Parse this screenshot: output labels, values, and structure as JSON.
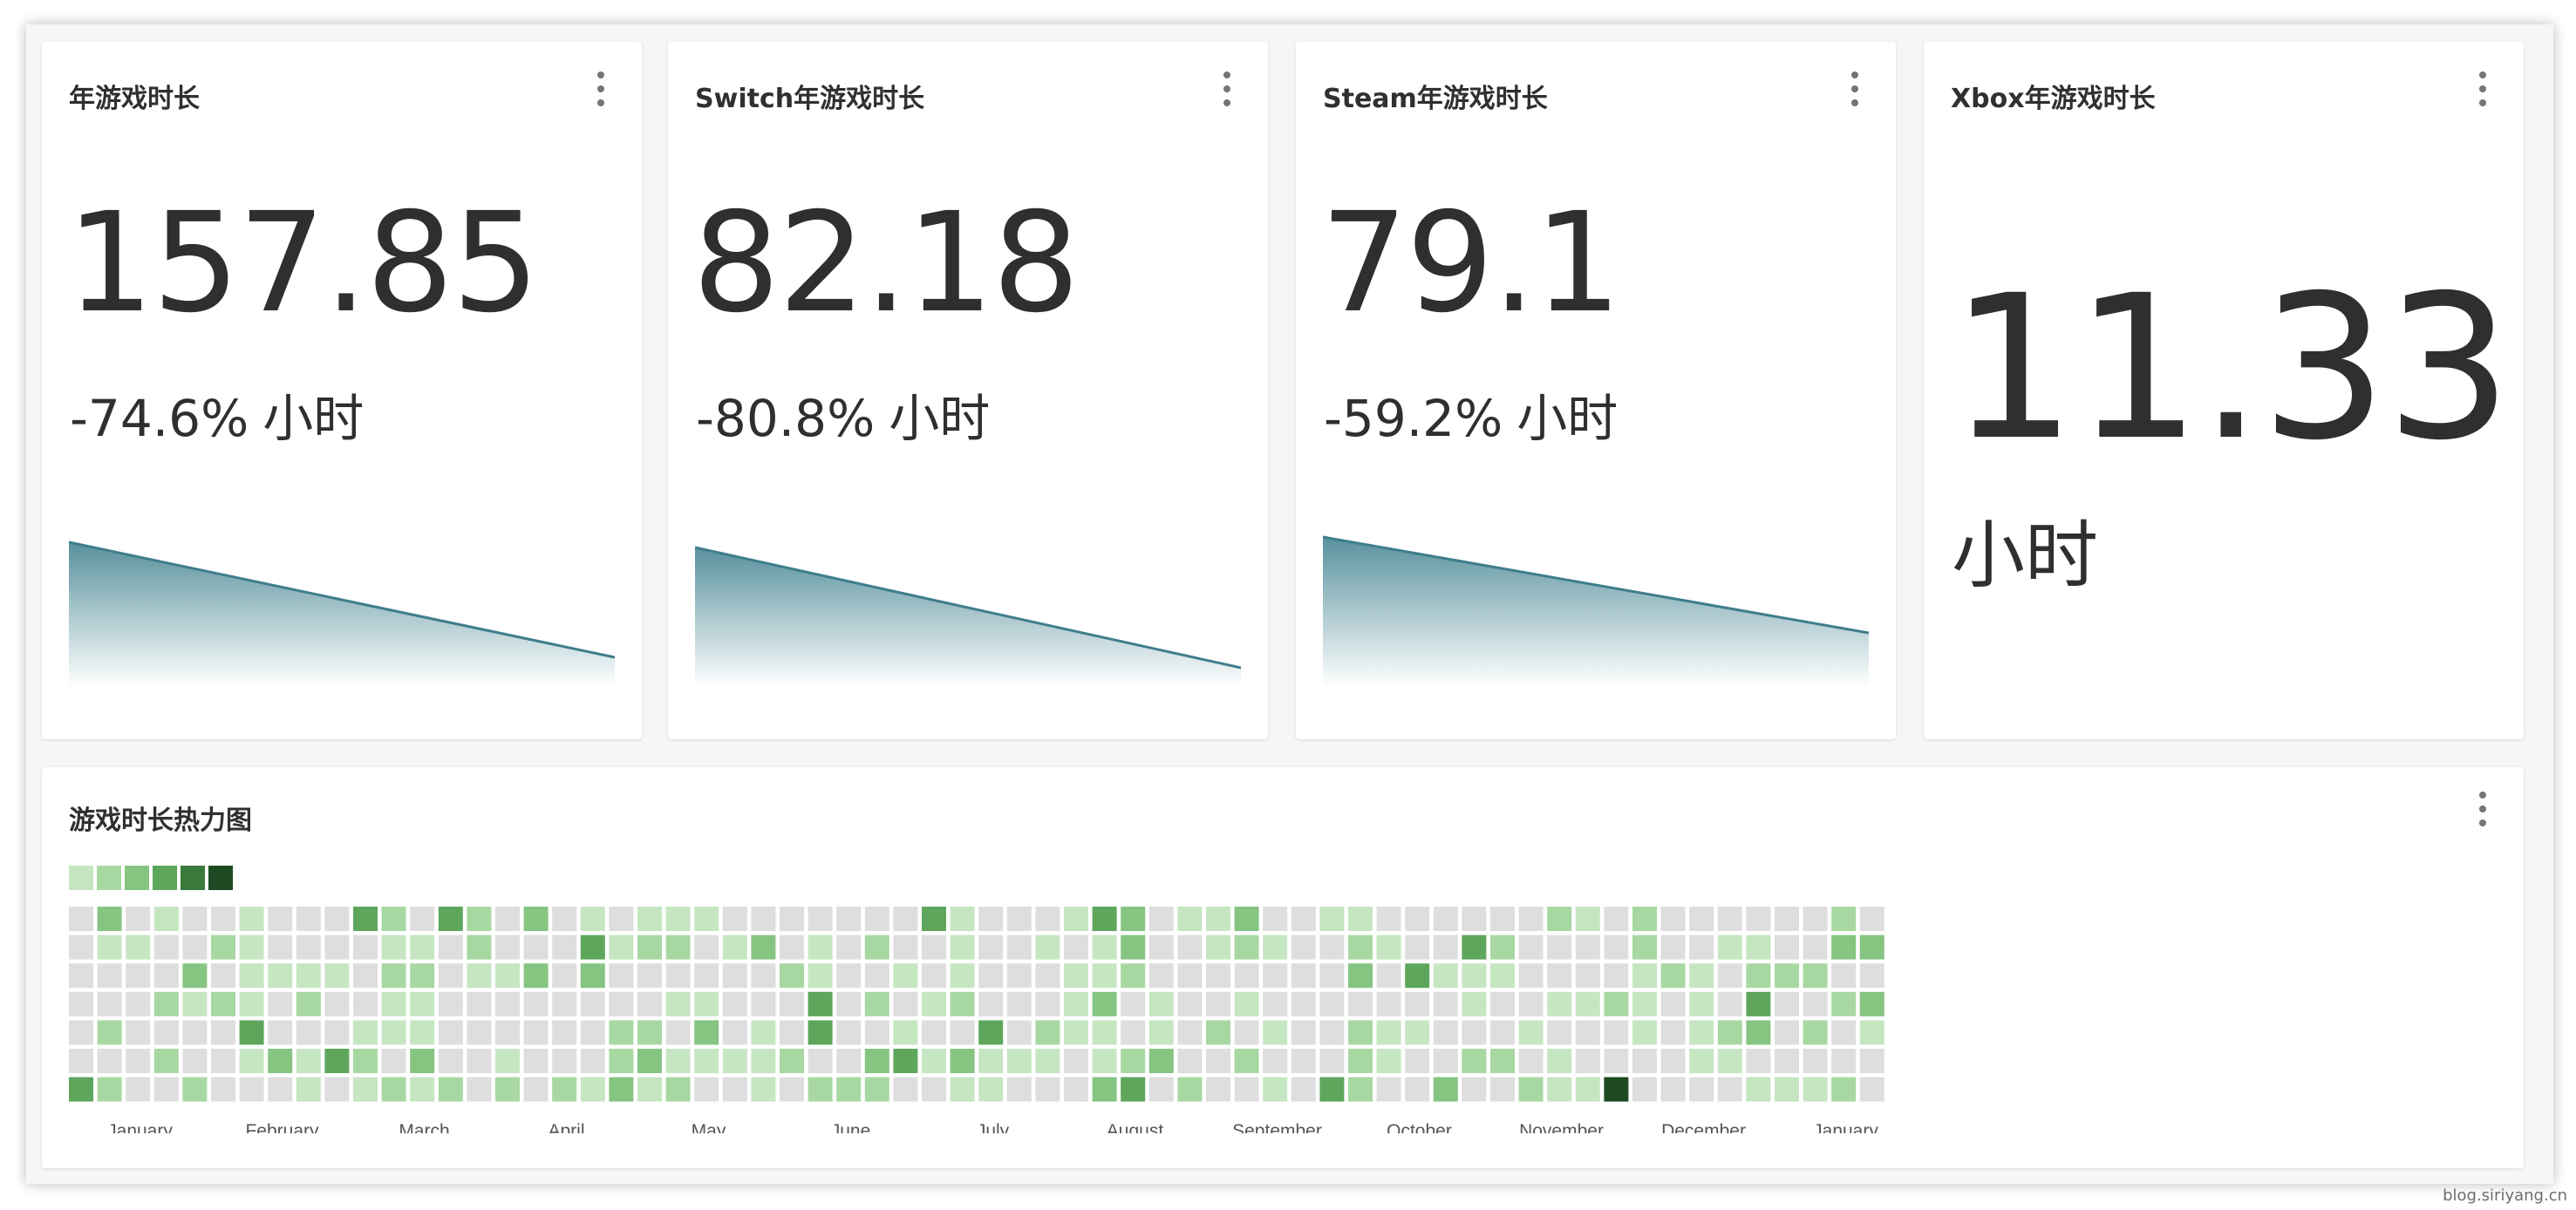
{
  "cards": [
    {
      "title": "年游戏时长",
      "value": "157.85",
      "change": "-74.6%",
      "unit": "小时",
      "trend": [
        100,
        0
      ]
    },
    {
      "title": "Switch年游戏时长",
      "value": "82.18",
      "change": "-80.8%",
      "unit": "小时",
      "trend": [
        100,
        0
      ]
    },
    {
      "title": "Steam年游戏时长",
      "value": "79.1",
      "change": "-59.2%",
      "unit": "小时",
      "trend": [
        100,
        0
      ]
    },
    {
      "title": "Xbox年游戏时长",
      "value": "11.33",
      "unit": "小时"
    }
  ],
  "heatmap": {
    "title": "游戏时长热力图",
    "months": [
      "January",
      "February",
      "March",
      "April",
      "May",
      "June",
      "July",
      "August",
      "September",
      "October",
      "November",
      "December",
      "January"
    ],
    "colors": {
      "empty": "#dedede",
      "scale": [
        "#c6e6c2",
        "#a8d8a2",
        "#86c482",
        "#5ea65c",
        "#3a7a3b",
        "#1d4a22"
      ]
    }
  },
  "footer": "blog.siriyang.cn"
}
